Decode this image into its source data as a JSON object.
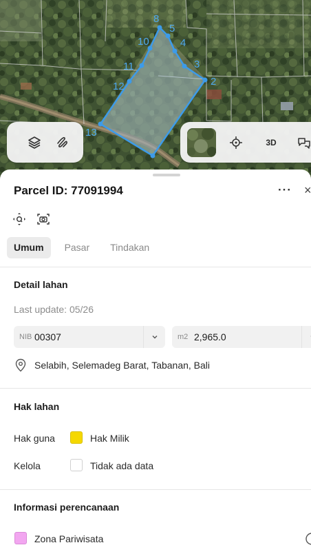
{
  "map": {
    "vertex_labels": [
      "8",
      "5",
      "10",
      "4",
      "11",
      "3",
      "12",
      "2",
      "13"
    ],
    "parcel_color": "#3d9be9",
    "controls": {
      "layers_icon": "layers-icon",
      "draw_icon": "draw-icon",
      "locate_icon": "crosshair-icon",
      "mode_3d_label": "3D",
      "compare_icon": "compare-icon"
    }
  },
  "sheet": {
    "title": "Parcel ID: 77091994",
    "more_label": "···",
    "close_label": "×",
    "tabs": [
      {
        "label": "Umum",
        "active": true
      },
      {
        "label": "Pasar",
        "active": false
      },
      {
        "label": "Tindakan",
        "active": false
      }
    ],
    "detail": {
      "heading": "Detail lahan",
      "last_update": "Last update: 05/26",
      "nib_prefix": "NIB",
      "nib_value": "00307",
      "area_prefix": "m2",
      "area_value": "2,965.0",
      "address": "Selabih, Selemadeg Barat, Tabanan, Bali"
    },
    "rights": {
      "heading": "Hak lahan",
      "hak_guna_label": "Hak guna",
      "hak_guna_value": "Hak Milik",
      "hak_guna_color": "#f5d800",
      "kelola_label": "Kelola",
      "kelola_value": "Tidak ada data"
    },
    "planning": {
      "heading": "Informasi perencanaan",
      "zone_label": "Zona Pariwisata",
      "zone_color": "#f2a6f0"
    }
  }
}
